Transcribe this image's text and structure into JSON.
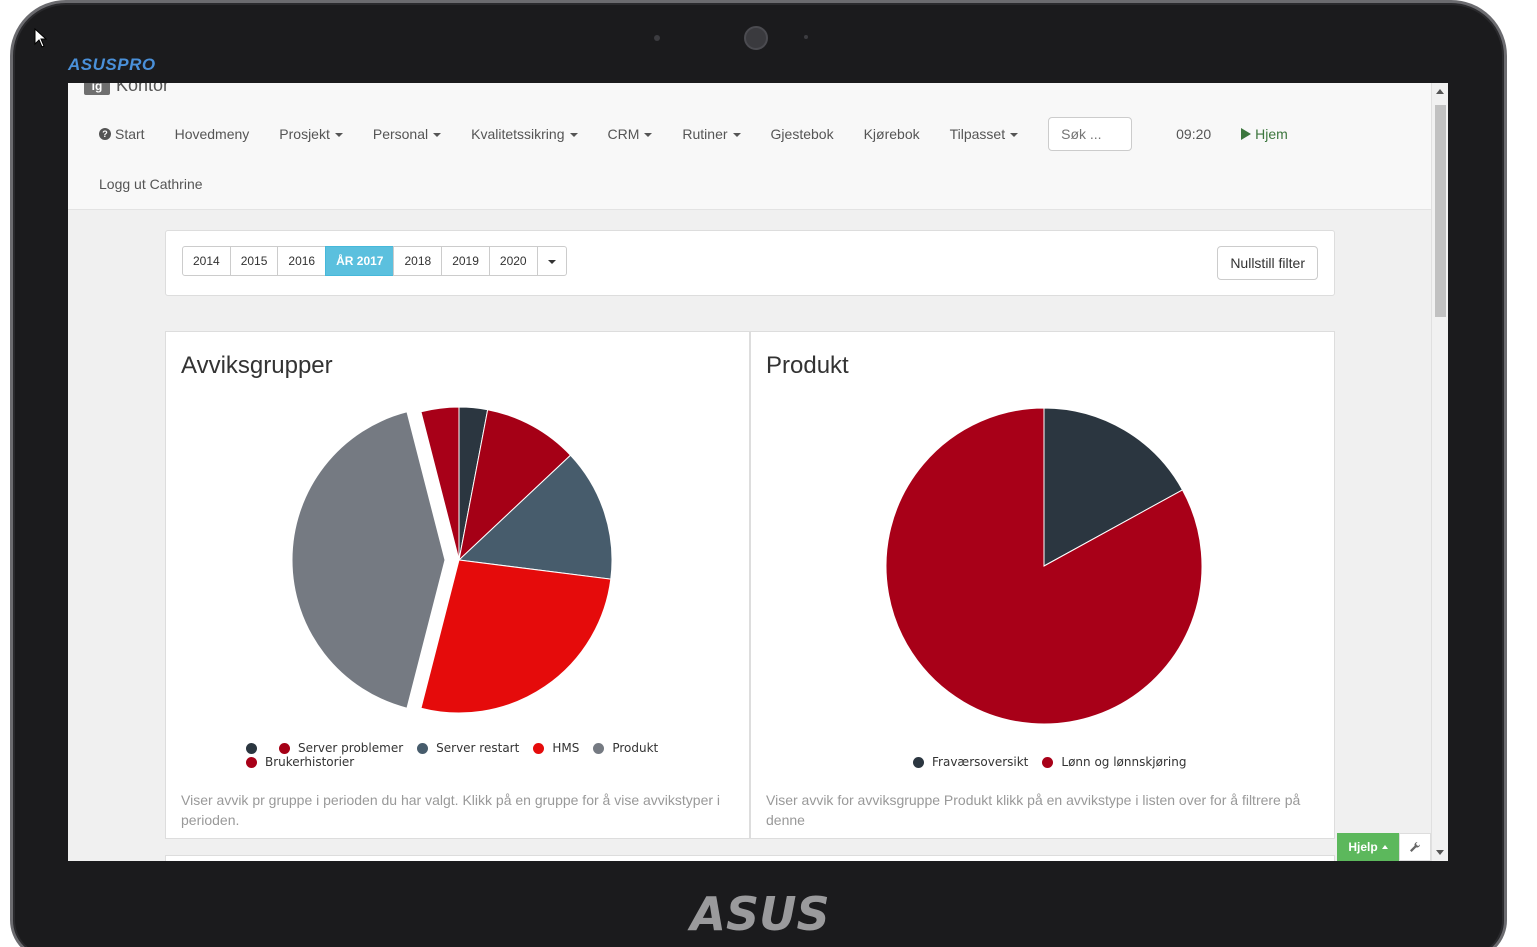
{
  "device": {
    "brand": "ASUSPRO",
    "logo": "ASUS"
  },
  "app": {
    "badge": "ig",
    "title": "Kontor"
  },
  "nav": {
    "start": "Start",
    "items": [
      {
        "label": "Hovedmeny",
        "dropdown": false
      },
      {
        "label": "Prosjekt",
        "dropdown": true
      },
      {
        "label": "Personal",
        "dropdown": true
      },
      {
        "label": "Kvalitetssikring",
        "dropdown": true
      },
      {
        "label": "CRM",
        "dropdown": true
      },
      {
        "label": "Rutiner",
        "dropdown": true
      },
      {
        "label": "Gjestebok",
        "dropdown": false
      },
      {
        "label": "Kjørebok",
        "dropdown": false
      },
      {
        "label": "Tilpasset",
        "dropdown": true
      }
    ],
    "search_placeholder": "Søk ...",
    "time": "09:20",
    "home": "Hjem",
    "logout": "Logg ut Cathrine"
  },
  "filter": {
    "years": [
      "2014",
      "2015",
      "2016",
      "ÅR 2017",
      "2018",
      "2019",
      "2020"
    ],
    "active_year": "ÅR 2017",
    "reset": "Nullstill filter"
  },
  "charts": {
    "left": {
      "title": "Avviksgrupper",
      "description": "Viser avvik pr gruppe i perioden du har valgt. Klikk på en gruppe for å vise avvikstyper i perioden."
    },
    "right": {
      "title": "Produkt",
      "description": "Viser avvik for avviksgruppe Produkt klikk på en avvikstype i listen over for å filtrere på denne"
    }
  },
  "chart_data": [
    {
      "type": "pie",
      "title": "Avviksgrupper",
      "series": [
        {
          "name": "",
          "value": 3,
          "color": "#2b3640"
        },
        {
          "name": "Server problemer",
          "value": 10,
          "color": "#a50016"
        },
        {
          "name": "Server restart",
          "value": 14,
          "color": "#475c6c"
        },
        {
          "name": "HMS",
          "value": 27,
          "color": "#e50b0b"
        },
        {
          "name": "Produkt",
          "value": 42,
          "color": "#757a82"
        },
        {
          "name": "Brukerhistorier",
          "value": 4,
          "color": "#a80018"
        }
      ],
      "exploded": "Produkt",
      "legend_position": "bottom"
    },
    {
      "type": "pie",
      "title": "Produkt",
      "series": [
        {
          "name": "Fraværsoversikt",
          "value": 17,
          "color": "#2b3640"
        },
        {
          "name": "Lønn og lønnskjøring",
          "value": 83,
          "color": "#a80018"
        }
      ],
      "legend_position": "bottom"
    }
  ],
  "footer": {
    "help": "Hjelp"
  }
}
